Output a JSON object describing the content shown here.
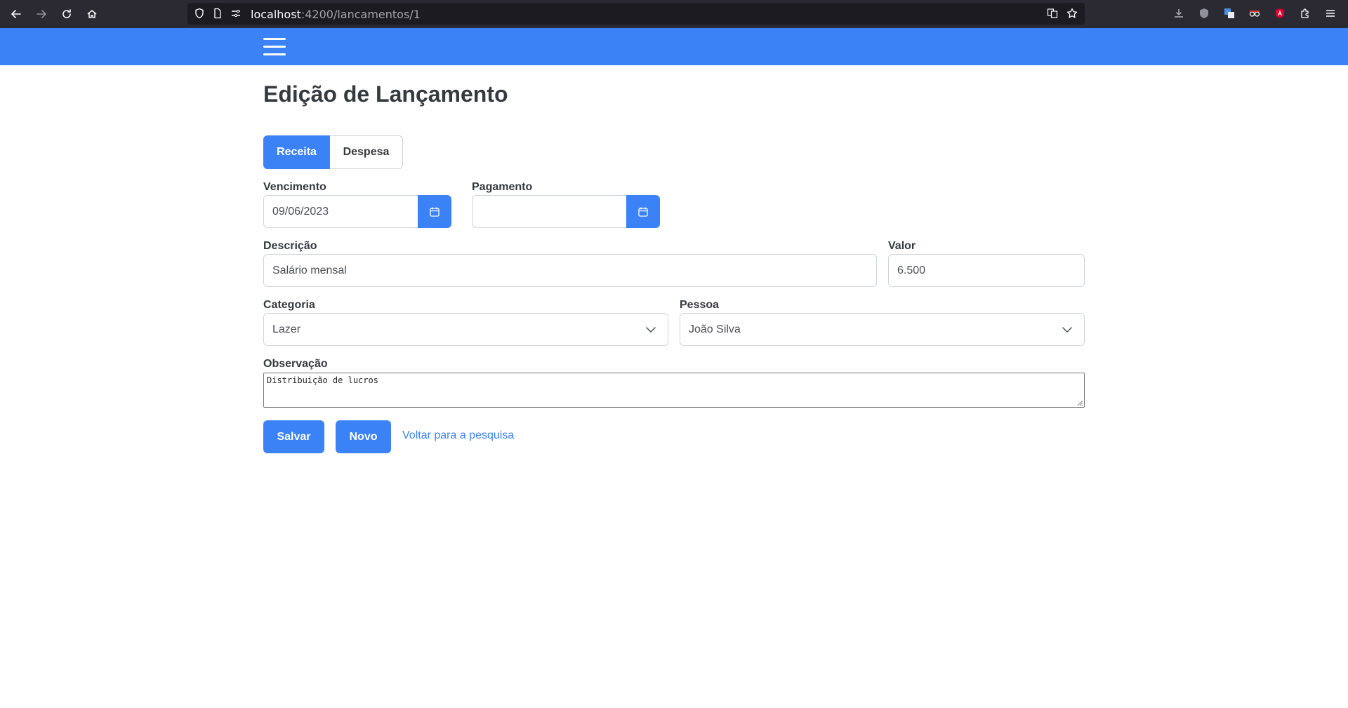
{
  "browser": {
    "url_host": "localhost",
    "url_path": ":4200/lancamentos/1"
  },
  "page": {
    "title": "Edição de Lançamento"
  },
  "tipo": {
    "options": [
      "Receita",
      "Despesa"
    ],
    "selected": "Receita"
  },
  "form": {
    "vencimento": {
      "label": "Vencimento",
      "value": "09/06/2023"
    },
    "pagamento": {
      "label": "Pagamento",
      "value": ""
    },
    "descricao": {
      "label": "Descrição",
      "value": "Salário mensal"
    },
    "valor": {
      "label": "Valor",
      "value": "6.500"
    },
    "categoria": {
      "label": "Categoria",
      "value": "Lazer"
    },
    "pessoa": {
      "label": "Pessoa",
      "value": "João Silva"
    },
    "observacao": {
      "label": "Observação",
      "value": "Distribuição de lucros"
    }
  },
  "actions": {
    "save_label": "Salvar",
    "new_label": "Novo",
    "back_label": "Voltar para a pesquisa"
  },
  "colors": {
    "primary": "#3b82f6",
    "header": "#3b82f6",
    "browser_chrome": "#2b2a33"
  }
}
